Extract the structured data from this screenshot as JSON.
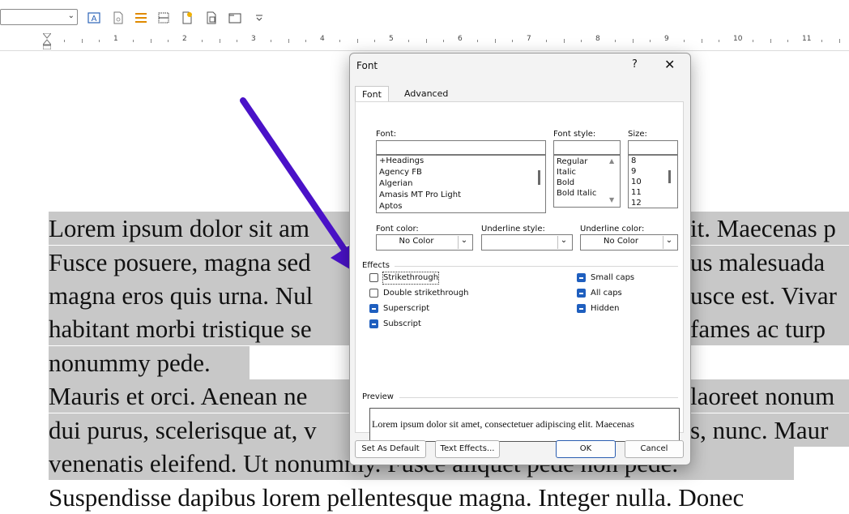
{
  "toolbar": {
    "icons": [
      "text-box-icon",
      "page-icon",
      "align-icon",
      "table-icon",
      "new-document-icon",
      "page-copy-icon",
      "frame-icon",
      "more-icon"
    ]
  },
  "ruler": {
    "numbers": [
      "1",
      "2",
      "3",
      "4",
      "5",
      "6",
      "7",
      "8",
      "9",
      "10",
      "11"
    ]
  },
  "document": {
    "lines": [
      {
        "left": "Lorem ipsum dolor sit am",
        "right": "it. Maecenas p"
      },
      {
        "left": "Fusce posuere, magna sed",
        "right": "us malesuada"
      },
      {
        "left": "magna eros quis urna. Nul",
        "right": "usce est. Vivar"
      },
      {
        "left": "habitant morbi tristique se",
        "right": "fames ac turp"
      },
      {
        "left": "nonummy pede.",
        "right": ""
      },
      {
        "left": "Mauris et orci. Aenean ne",
        "right": "laoreet nonum"
      },
      {
        "left": "dui purus, scelerisque at, v",
        "right": "s, nunc. Maur"
      },
      {
        "left": "venenatis eleifend. Ut nonummy. Fusce aliquet pede non pede.",
        "right": ""
      },
      {
        "left": "Suspendisse dapibus lorem pellentesque magna. Integer nulla. Donec",
        "right": ""
      }
    ]
  },
  "dialog": {
    "title": "Font",
    "help": "?",
    "close": "✕",
    "tabs": [
      {
        "label": "Font"
      },
      {
        "label": "Advanced"
      }
    ],
    "font": {
      "label": "Font:",
      "value": "",
      "items": [
        "+Headings",
        "Agency FB",
        "Algerian",
        "Amasis MT Pro Light",
        "Aptos"
      ]
    },
    "style": {
      "label": "Font style:",
      "value": "",
      "items": [
        "Regular",
        "Italic",
        "Bold",
        "Bold Italic"
      ]
    },
    "size": {
      "label": "Size:",
      "value": "",
      "items": [
        "8",
        "9",
        "10",
        "11",
        "12"
      ]
    },
    "font_color": {
      "label": "Font color:",
      "value": "No Color"
    },
    "underline_style": {
      "label": "Underline style:",
      "value": ""
    },
    "underline_color": {
      "label": "Underline color:",
      "value": "No Color"
    },
    "effects": {
      "title": "Effects",
      "left": [
        {
          "label": "Strikethrough",
          "state": "unchecked"
        },
        {
          "label": "Double strikethrough",
          "state": "unchecked"
        },
        {
          "label": "Superscript",
          "state": "mixed"
        },
        {
          "label": "Subscript",
          "state": "mixed"
        }
      ],
      "right": [
        {
          "label": "Small caps",
          "state": "mixed"
        },
        {
          "label": "All caps",
          "state": "mixed"
        },
        {
          "label": "Hidden",
          "state": "mixed"
        }
      ]
    },
    "preview": {
      "title": "Preview",
      "text": "Lorem ipsum dolor sit amet, consectetuer adipiscing elit. Maecenas"
    },
    "buttons": {
      "set_default": "Set As Default",
      "text_effects": "Text Effects...",
      "ok": "OK",
      "cancel": "Cancel"
    }
  },
  "colors": {
    "highlight": "#c8c8c8",
    "arrow": "#4a12c8",
    "checkbox_accent": "#1f5fbf"
  }
}
